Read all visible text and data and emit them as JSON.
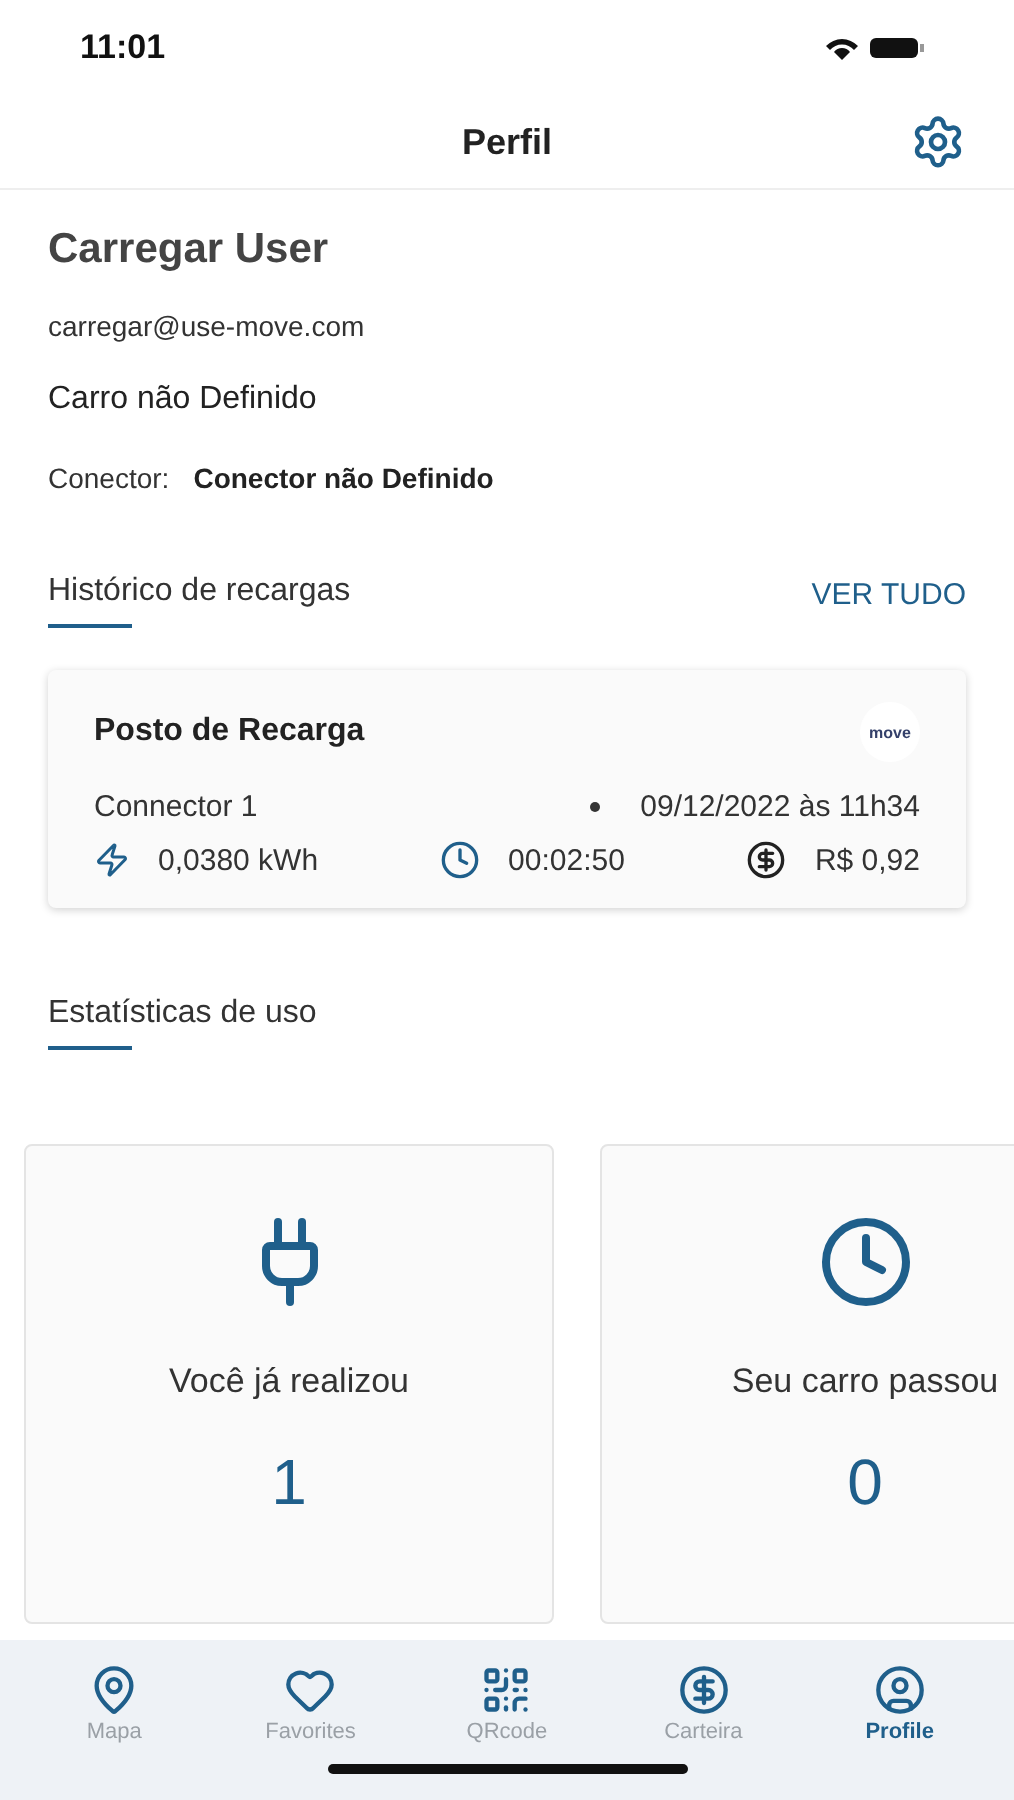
{
  "status_bar": {
    "time": "11:01"
  },
  "header": {
    "title": "Perfil"
  },
  "profile": {
    "name": "Carregar User",
    "email": "carregar@use-move.com",
    "car": "Carro não Definido",
    "connector_label": "Conector:",
    "connector_value": "Conector não Definido"
  },
  "history": {
    "title": "Histórico de recargas",
    "link": "VER TUDO",
    "card": {
      "station": "Posto de Recarga",
      "logo": "move",
      "connector": "Connector 1",
      "date": "09/12/2022 às 11h34",
      "energy": "0,0380 kWh",
      "duration": "00:02:50",
      "cost": "R$ 0,92"
    }
  },
  "stats": {
    "title": "Estatísticas de uso",
    "cards": [
      {
        "kind": "plug",
        "label": "Você já realizou",
        "value": "1"
      },
      {
        "kind": "clock",
        "label": "Seu carro passou",
        "value": "0"
      }
    ]
  },
  "tab_bar": [
    {
      "kind": "map",
      "label": "Mapa",
      "selected": false
    },
    {
      "kind": "heart",
      "label": "Favorites",
      "selected": false
    },
    {
      "kind": "qr",
      "label": "QRcode",
      "selected": false
    },
    {
      "kind": "wallet",
      "label": "Carteira",
      "selected": false
    },
    {
      "kind": "profile",
      "label": "Profile",
      "selected": true
    }
  ]
}
